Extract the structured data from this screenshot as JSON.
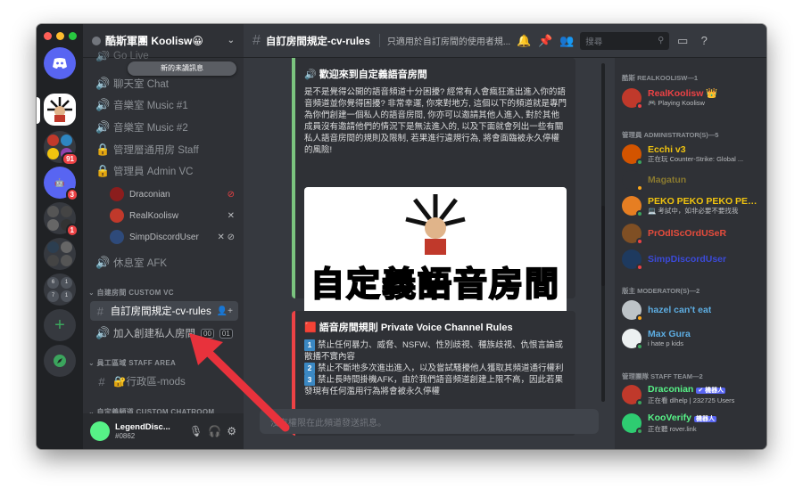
{
  "server": {
    "name": "酷斯軍團 Koolisw😀",
    "new_unread": "新的未讀訊息",
    "top_cut": "Go Live"
  },
  "guild_badges": [
    "91",
    "3",
    "1"
  ],
  "guild_folder1": [
    "6",
    "1",
    "7",
    "1"
  ],
  "channels": [
    {
      "label": "聊天室 Chat"
    },
    {
      "label": "音樂室 Music #1"
    },
    {
      "label": "音樂室 Music #2"
    },
    {
      "label": "管理層通用房 Staff"
    },
    {
      "label": "管理員 Admin VC"
    }
  ],
  "voice_users": [
    {
      "name": "Draconian"
    },
    {
      "name": "RealKoolisw"
    },
    {
      "name": "SimpDiscordUser"
    }
  ],
  "afk": "休息室 AFK",
  "categories": {
    "custom_vc": "自建房間 CUSTOM VC",
    "staff_area": "員工區域 STAFF AREA",
    "custom_chatroom": "自定義頻道 CUSTOM CHATROOM"
  },
  "custom_vc": {
    "rules_channel": "自訂房間規定-cv-rules",
    "join_channel": "加入創建私人房間",
    "count_a": "00",
    "count_b": "01"
  },
  "staff_channel": "🔐行政區-mods",
  "user": {
    "name": "LegendDisc...",
    "tag": "#0862"
  },
  "header": {
    "channel": "自訂房間規定-cv-rules",
    "topic": "只適用於自訂房間的使用者規...",
    "search_placeholder": "搜尋"
  },
  "welcome": {
    "title": "歡迎來到自定義語音房間",
    "body": "是不是覺得公開的語音頻道十分困擾? 經常有人會瘋狂進出進入你的語音頻道並你覺得困擾? 非常幸運, 你來對地方, 這個以下的頻道就是專門為你們創建一個私人的語音房間, 你亦可以邀請其他人進入, 對於其他成員沒有邀請他們的情況下是無法進入的, 以及下面就會列出一些有關私人語音房間的規則及限制, 若果進行違規行為, 將會面臨被永久停權的風險!",
    "image_text": "自定義語音房間"
  },
  "rules": {
    "title": "語音房間規則 Private Voice Channel Rules",
    "items": [
      {
        "n": "1",
        "text": "禁止任何暴力、威脅、NSFW、性別歧視、種族歧視、仇恨言論或散播不實內容"
      },
      {
        "n": "2",
        "text": "禁止不斷地多次進出進入，以及嘗試騷擾他人獲取其頻道通行權利"
      },
      {
        "n": "3",
        "text": "禁止長時間掛機AFK，由於我們語音頻道創建上限不高，因此若果發現有任何濫用行為將會被永久停權"
      }
    ]
  },
  "input_placeholder": "沒有權限在此頻道發送訊息。",
  "members": {
    "owner_cat": "酷斯 REALKOOLISW—1",
    "admin_cat": "管理員 ADMINISTRATOR(S)—5",
    "mod_cat": "版主 MODERATOR(S)—2",
    "staff_cat": "管理團隊 STAFF TEAM—2",
    "list": [
      {
        "name": "RealKoolisw 👑",
        "activity": "🎮 Playing Koolisw",
        "color": "#ed4245"
      },
      {
        "name": "Ecchi v3",
        "activity": "正在玩 Counter-Strike: Global ...",
        "color": "#f1c40f"
      },
      {
        "name": "Magatun",
        "activity": "",
        "color": "#8a7a30"
      },
      {
        "name": "PEKO PEKO PEKO PEK...",
        "activity": "💻 考試中，如非必要不要找我",
        "color": "#f1c40f"
      },
      {
        "name": "PrOdIScOrdUSeR",
        "activity": "",
        "color": "#e74c3c"
      },
      {
        "name": "SimpDiscordUser",
        "activity": "",
        "color": "#3b4ad9"
      },
      {
        "name": "hazel can't eat",
        "activity": "",
        "color": "#5dade2"
      },
      {
        "name": "Max Gura",
        "activity": "i hate p kids",
        "color": "#5dade2"
      },
      {
        "name": "Draconian",
        "activity": "正在看 dlhelp | 232725 Users",
        "color": "#57f287",
        "bot": "✔ 機器人"
      },
      {
        "name": "KooVerify",
        "activity": "正在聽 rover.link",
        "color": "#57f287",
        "bot": "機器人"
      }
    ]
  }
}
